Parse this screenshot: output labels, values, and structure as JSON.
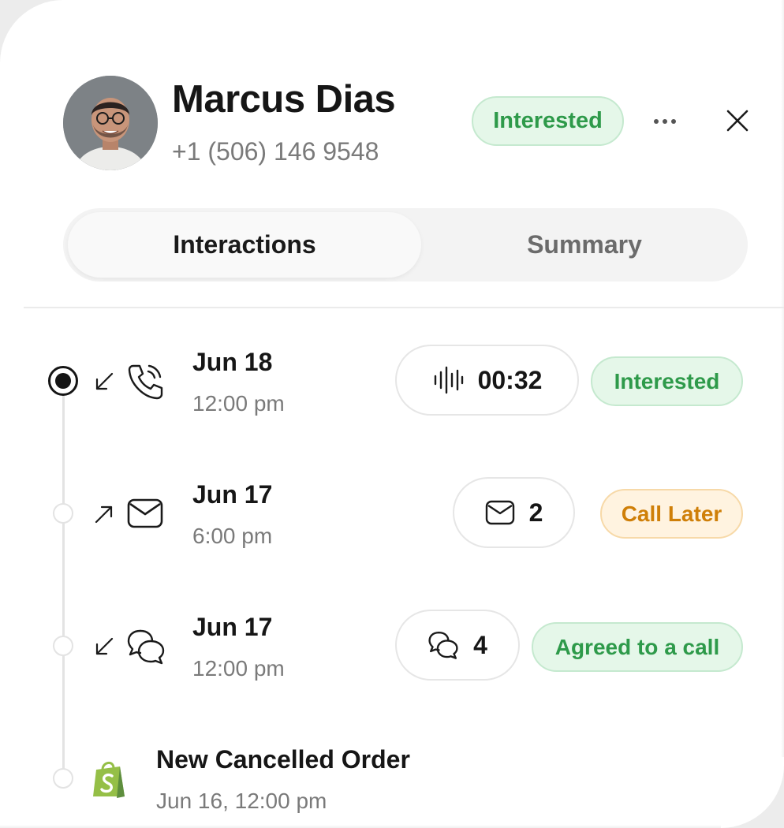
{
  "contact": {
    "name": "Marcus Dias",
    "phone": "+1 (506) 146 9548",
    "status": "Interested"
  },
  "tabs": [
    {
      "label": "Interactions",
      "active": true
    },
    {
      "label": "Summary",
      "active": false
    }
  ],
  "interactions": [
    {
      "direction": "incoming",
      "channel": "phone-call-icon",
      "date": "Jun 18",
      "time": "12:00 pm",
      "meta_icon": "audio-waveform-icon",
      "meta_value": "00:32",
      "status": "Interested",
      "status_color": "green"
    },
    {
      "direction": "outgoing",
      "channel": "email-icon",
      "date": "Jun 17",
      "time": "6:00 pm",
      "meta_icon": "email-icon",
      "meta_value": "2",
      "status": "Call Later",
      "status_color": "orange"
    },
    {
      "direction": "incoming",
      "channel": "chat-icon",
      "date": "Jun 17",
      "time": "12:00 pm",
      "meta_icon": "chat-icon",
      "meta_value": "4",
      "status": "Agreed to a call",
      "status_color": "green"
    }
  ],
  "order_event": {
    "icon": "shopify-icon",
    "title": "New Cancelled Order",
    "datetime": "Jun 16, 12:00 pm"
  },
  "colors": {
    "green_text": "#2e9a4a",
    "green_bg": "#e5f7e9",
    "orange_text": "#cf7f08",
    "orange_bg": "#fff3e0",
    "shopify_green": "#95bf47"
  }
}
